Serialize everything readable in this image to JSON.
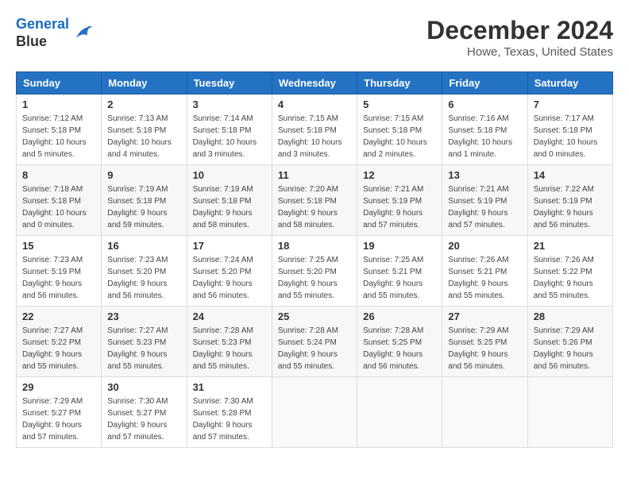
{
  "header": {
    "logo_line1": "General",
    "logo_line2": "Blue",
    "month_title": "December 2024",
    "location": "Howe, Texas, United States"
  },
  "weekdays": [
    "Sunday",
    "Monday",
    "Tuesday",
    "Wednesday",
    "Thursday",
    "Friday",
    "Saturday"
  ],
  "weeks": [
    [
      {
        "day": "1",
        "sunrise": "7:12 AM",
        "sunset": "5:18 PM",
        "daylight": "10 hours and 5 minutes."
      },
      {
        "day": "2",
        "sunrise": "7:13 AM",
        "sunset": "5:18 PM",
        "daylight": "10 hours and 4 minutes."
      },
      {
        "day": "3",
        "sunrise": "7:14 AM",
        "sunset": "5:18 PM",
        "daylight": "10 hours and 3 minutes."
      },
      {
        "day": "4",
        "sunrise": "7:15 AM",
        "sunset": "5:18 PM",
        "daylight": "10 hours and 3 minutes."
      },
      {
        "day": "5",
        "sunrise": "7:15 AM",
        "sunset": "5:18 PM",
        "daylight": "10 hours and 2 minutes."
      },
      {
        "day": "6",
        "sunrise": "7:16 AM",
        "sunset": "5:18 PM",
        "daylight": "10 hours and 1 minute."
      },
      {
        "day": "7",
        "sunrise": "7:17 AM",
        "sunset": "5:18 PM",
        "daylight": "10 hours and 0 minutes."
      }
    ],
    [
      {
        "day": "8",
        "sunrise": "7:18 AM",
        "sunset": "5:18 PM",
        "daylight": "10 hours and 0 minutes."
      },
      {
        "day": "9",
        "sunrise": "7:19 AM",
        "sunset": "5:18 PM",
        "daylight": "9 hours and 59 minutes."
      },
      {
        "day": "10",
        "sunrise": "7:19 AM",
        "sunset": "5:18 PM",
        "daylight": "9 hours and 58 minutes."
      },
      {
        "day": "11",
        "sunrise": "7:20 AM",
        "sunset": "5:18 PM",
        "daylight": "9 hours and 58 minutes."
      },
      {
        "day": "12",
        "sunrise": "7:21 AM",
        "sunset": "5:19 PM",
        "daylight": "9 hours and 57 minutes."
      },
      {
        "day": "13",
        "sunrise": "7:21 AM",
        "sunset": "5:19 PM",
        "daylight": "9 hours and 57 minutes."
      },
      {
        "day": "14",
        "sunrise": "7:22 AM",
        "sunset": "5:19 PM",
        "daylight": "9 hours and 56 minutes."
      }
    ],
    [
      {
        "day": "15",
        "sunrise": "7:23 AM",
        "sunset": "5:19 PM",
        "daylight": "9 hours and 56 minutes."
      },
      {
        "day": "16",
        "sunrise": "7:23 AM",
        "sunset": "5:20 PM",
        "daylight": "9 hours and 56 minutes."
      },
      {
        "day": "17",
        "sunrise": "7:24 AM",
        "sunset": "5:20 PM",
        "daylight": "9 hours and 56 minutes."
      },
      {
        "day": "18",
        "sunrise": "7:25 AM",
        "sunset": "5:20 PM",
        "daylight": "9 hours and 55 minutes."
      },
      {
        "day": "19",
        "sunrise": "7:25 AM",
        "sunset": "5:21 PM",
        "daylight": "9 hours and 55 minutes."
      },
      {
        "day": "20",
        "sunrise": "7:26 AM",
        "sunset": "5:21 PM",
        "daylight": "9 hours and 55 minutes."
      },
      {
        "day": "21",
        "sunrise": "7:26 AM",
        "sunset": "5:22 PM",
        "daylight": "9 hours and 55 minutes."
      }
    ],
    [
      {
        "day": "22",
        "sunrise": "7:27 AM",
        "sunset": "5:22 PM",
        "daylight": "9 hours and 55 minutes."
      },
      {
        "day": "23",
        "sunrise": "7:27 AM",
        "sunset": "5:23 PM",
        "daylight": "9 hours and 55 minutes."
      },
      {
        "day": "24",
        "sunrise": "7:28 AM",
        "sunset": "5:23 PM",
        "daylight": "9 hours and 55 minutes."
      },
      {
        "day": "25",
        "sunrise": "7:28 AM",
        "sunset": "5:24 PM",
        "daylight": "9 hours and 55 minutes."
      },
      {
        "day": "26",
        "sunrise": "7:28 AM",
        "sunset": "5:25 PM",
        "daylight": "9 hours and 56 minutes."
      },
      {
        "day": "27",
        "sunrise": "7:29 AM",
        "sunset": "5:25 PM",
        "daylight": "9 hours and 56 minutes."
      },
      {
        "day": "28",
        "sunrise": "7:29 AM",
        "sunset": "5:26 PM",
        "daylight": "9 hours and 56 minutes."
      }
    ],
    [
      {
        "day": "29",
        "sunrise": "7:29 AM",
        "sunset": "5:27 PM",
        "daylight": "9 hours and 57 minutes."
      },
      {
        "day": "30",
        "sunrise": "7:30 AM",
        "sunset": "5:27 PM",
        "daylight": "9 hours and 57 minutes."
      },
      {
        "day": "31",
        "sunrise": "7:30 AM",
        "sunset": "5:28 PM",
        "daylight": "9 hours and 57 minutes."
      },
      null,
      null,
      null,
      null
    ]
  ]
}
